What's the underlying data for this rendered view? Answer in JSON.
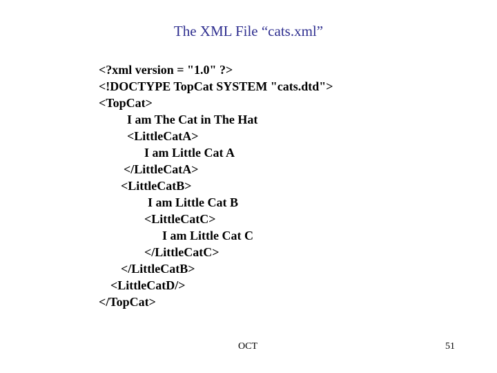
{
  "slide": {
    "title": "The XML File “cats.xml”",
    "code_lines": [
      "<?xml version = \"1.0\" ?>",
      "<!DOCTYPE TopCat SYSTEM \"cats.dtd\">",
      "<TopCat>",
      "I am The Cat in The Hat",
      "<LittleCatA>",
      "I am Little Cat A",
      "</LittleCatA>",
      "<LittleCatB>",
      "I am Little Cat B",
      "<LittleCatC>",
      "I am Little Cat C",
      "</LittleCatC>",
      "</LittleCatB>",
      "<LittleCatD/>",
      "</TopCat>"
    ],
    "footer": {
      "center": "OCT",
      "page_number": "51"
    }
  }
}
